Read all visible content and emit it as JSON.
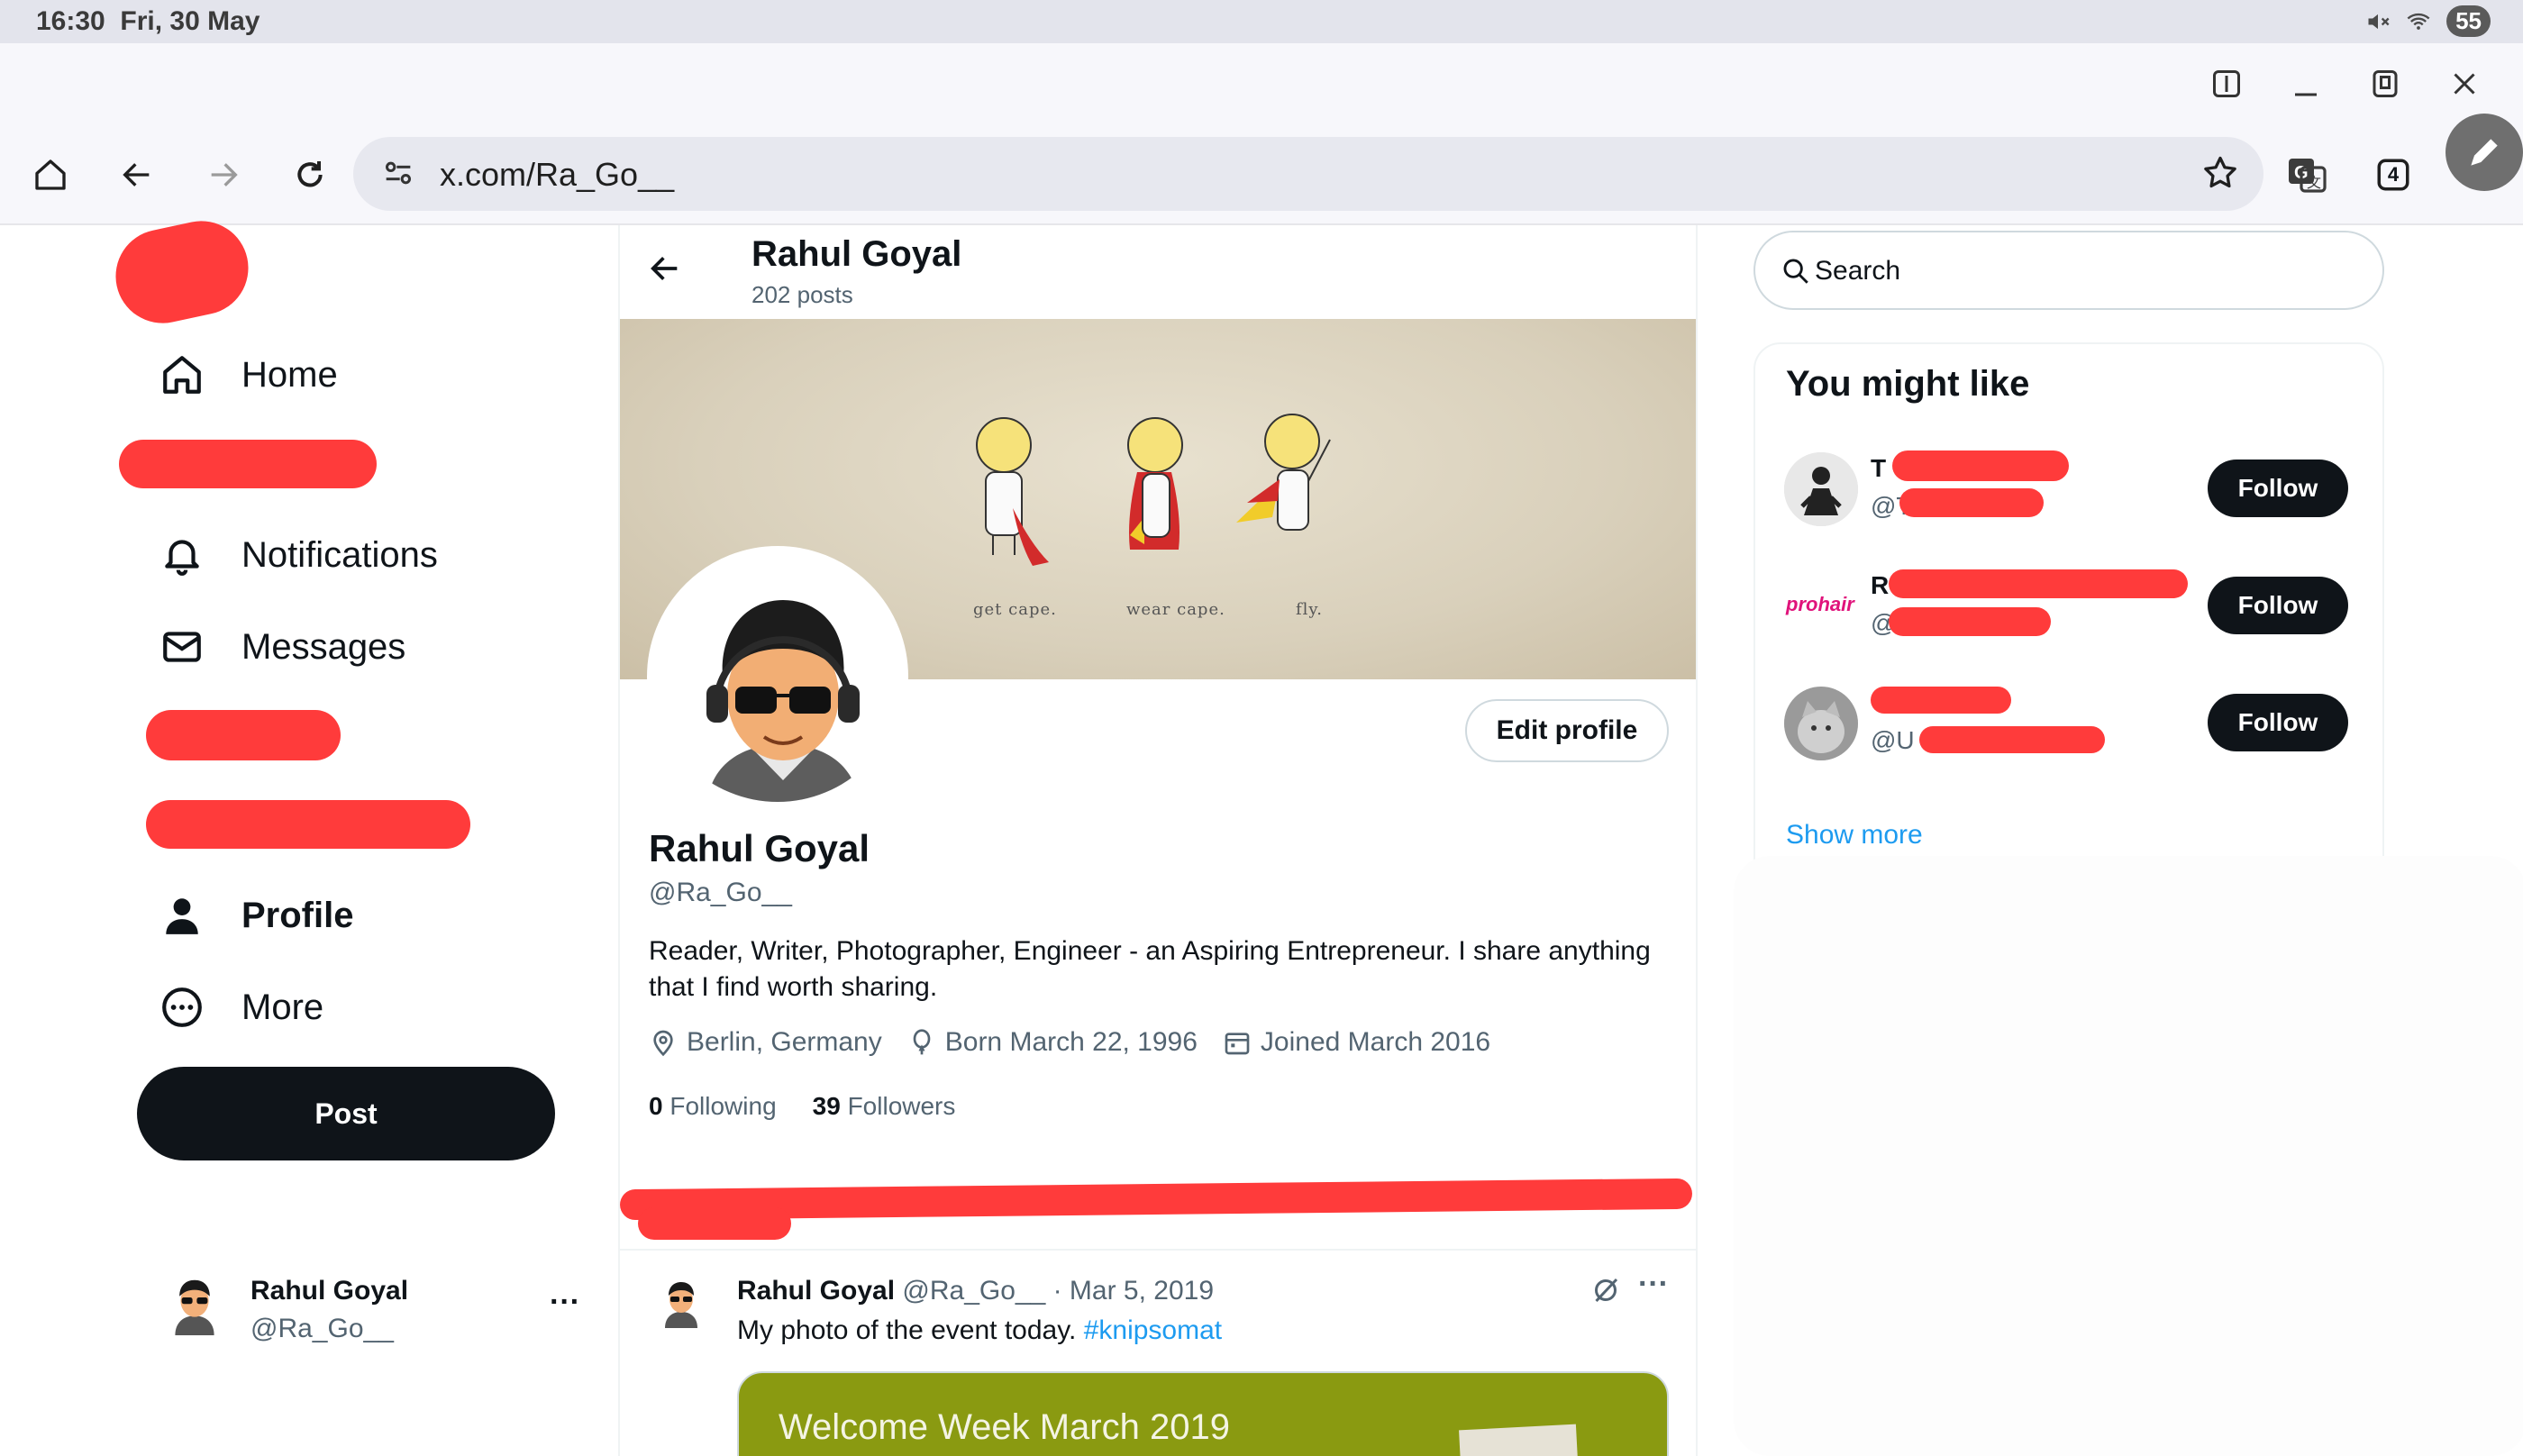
{
  "status_bar": {
    "time": "16:30",
    "date": "Fri, 30 May",
    "battery": "55"
  },
  "browser": {
    "url": "x.com/Ra_Go__",
    "tab_count": "4"
  },
  "nav": {
    "items": [
      {
        "label": "Home",
        "icon": "home-icon"
      },
      {
        "label": "Notifications",
        "icon": "bell-icon"
      },
      {
        "label": "Messages",
        "icon": "mail-icon"
      },
      {
        "label": "Profile",
        "icon": "person-icon"
      },
      {
        "label": "More",
        "icon": "more-circle-icon"
      }
    ],
    "post_label": "Post",
    "account": {
      "name": "Rahul Goyal",
      "handle": "@Ra_Go__",
      "more": "···"
    }
  },
  "profile": {
    "header_name": "Rahul Goyal",
    "posts_count": "202 posts",
    "banner_captions": [
      "get cape.",
      "wear cape.",
      "fly."
    ],
    "edit_label": "Edit profile",
    "name": "Rahul Goyal",
    "handle": "@Ra_Go__",
    "bio": "Reader, Writer, Photographer, Engineer - an Aspiring Entrepreneur. I share anything that I find worth sharing.",
    "location": "Berlin, Germany",
    "born": "Born March 22, 1996",
    "joined": "Joined March 2016",
    "following_count": "0",
    "following_label": "Following",
    "followers_count": "39",
    "followers_label": "Followers"
  },
  "tweet": {
    "name": "Rahul Goyal",
    "meta": "@Ra_Go__ · Mar 5, 2019",
    "text": "My photo of the event today.",
    "hashtag": "#knipsomat",
    "media_title": "Welcome Week March 2019",
    "more": "···"
  },
  "sidebar": {
    "search_placeholder": "Search",
    "title": "You might like",
    "suggestions": [
      {
        "name": "T",
        "handle": "@T",
        "follow": "Follow"
      },
      {
        "name": "R",
        "handle": "@R",
        "follow": "Follow",
        "logo": "prohair"
      },
      {
        "name": "",
        "handle": "@U",
        "follow": "Follow"
      }
    ],
    "show_more": "Show more"
  },
  "colors": {
    "accent": "#1d9bf0",
    "dark": "#0f1419",
    "redaction": "#ff3b3b",
    "muted": "#536471"
  }
}
